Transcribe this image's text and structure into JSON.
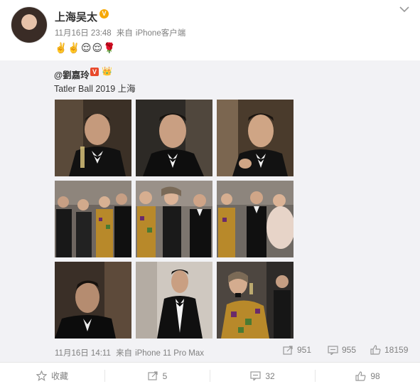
{
  "post": {
    "author": "上海吴太",
    "verified_badge": "V",
    "time": "11月16日 23:48",
    "source_prefix": "来自",
    "source": "iPhone客户端",
    "emojis": "✌️✌️😌😌🌹"
  },
  "repost": {
    "author": "@劉嘉玲",
    "badge": "V",
    "text": "Tatler Ball 2019 上海",
    "time": "11月16日 14:11",
    "source_prefix": "来自",
    "source": "iPhone 11 Pro Max",
    "stats": {
      "reposts": "951",
      "comments": "955",
      "likes": "18159"
    },
    "photos": [
      {
        "name": "tuxedo-man-wine"
      },
      {
        "name": "tuxedo-man-closeup"
      },
      {
        "name": "tuxedo-man-smile"
      },
      {
        "name": "group-four-people"
      },
      {
        "name": "group-women-man"
      },
      {
        "name": "group-feather-dress"
      },
      {
        "name": "man-profile-dark"
      },
      {
        "name": "man-standing-tuxedo"
      },
      {
        "name": "woman-drinking"
      }
    ]
  },
  "actions": {
    "favorite": "收藏",
    "repost": "5",
    "comment": "32",
    "like": "98"
  },
  "colors": {
    "accent": "#f7a800",
    "red_badge": "#e8492c",
    "gray_text": "#808080",
    "repost_bg": "#f2f2f5"
  }
}
